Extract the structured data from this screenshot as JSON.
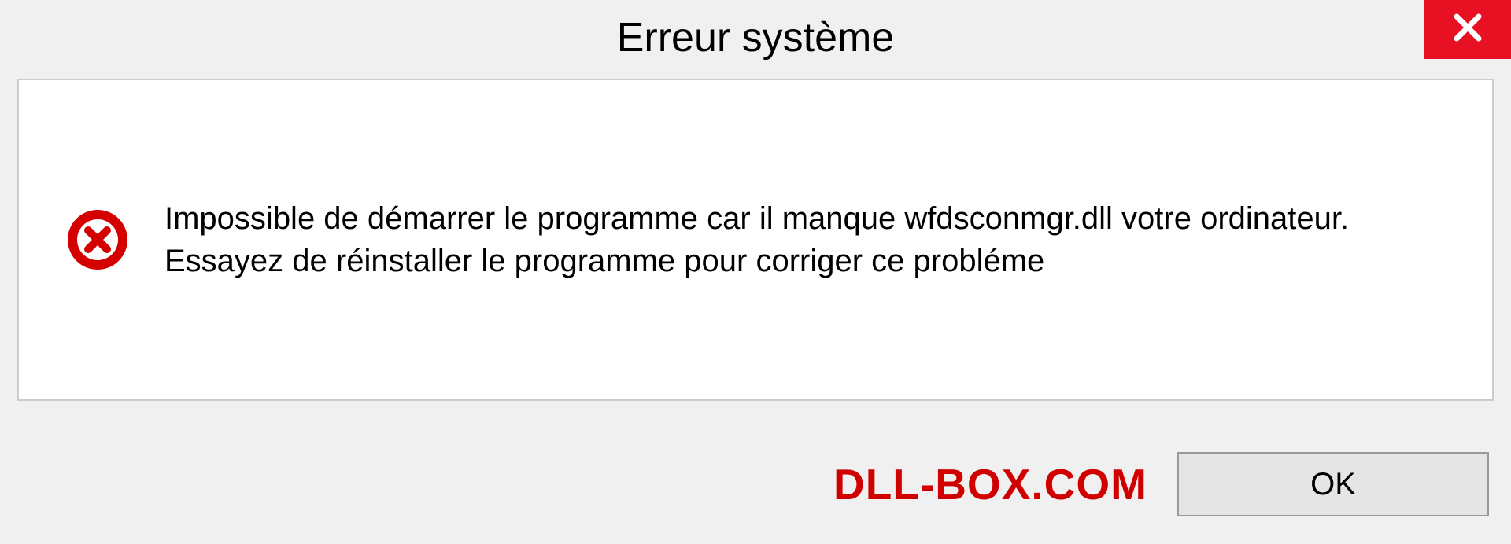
{
  "dialog": {
    "title": "Erreur système",
    "message": "Impossible de démarrer le programme car il manque wfdsconmgr.dll votre ordinateur. Essayez de réinstaller le programme pour corriger ce probléme",
    "ok_label": "OK"
  },
  "watermark": "DLL-BOX.COM"
}
